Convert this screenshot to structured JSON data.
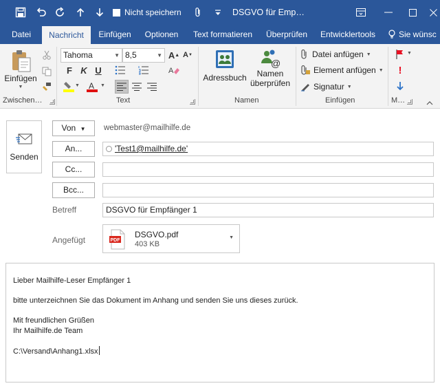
{
  "window": {
    "title": "DSGVO für Emp…",
    "quick_access": {
      "nosave_label": "Nicht speichern"
    }
  },
  "tabs": [
    {
      "label": "Datei"
    },
    {
      "label": "Nachricht"
    },
    {
      "label": "Einfügen"
    },
    {
      "label": "Optionen"
    },
    {
      "label": "Text formatieren"
    },
    {
      "label": "Überprüfen"
    },
    {
      "label": "Entwicklertools"
    }
  ],
  "tell_me": "Sie wünsc",
  "ribbon": {
    "clipboard": {
      "paste_label": "Einfügen",
      "group_label": "Zwischen…"
    },
    "text": {
      "font_name": "Tahoma",
      "font_size": "8,5",
      "bold": "F",
      "italic": "K",
      "underline": "U",
      "group_label": "Text"
    },
    "names": {
      "addressbook_label": "Adressbuch",
      "check_names_line1": "Namen",
      "check_names_line2": "überprüfen",
      "group_label": "Namen"
    },
    "include": {
      "attach_file": "Datei anfügen",
      "attach_item": "Element anfügen",
      "signature": "Signatur",
      "group_label": "Einfügen"
    },
    "tags": {
      "group_label": "M…"
    }
  },
  "compose": {
    "send_label": "Senden",
    "from_btn": "Von",
    "from_address": "webmaster@mailhilfe.de",
    "to_btn": "An...",
    "to_value": "'Test1@mailhilfe.de'",
    "cc_btn": "Cc...",
    "bcc_btn": "Bcc...",
    "subject_label": "Betreff",
    "subject_value": "DSGVO für Empfänger 1",
    "attached_label": "Angefügt",
    "attachment": {
      "name": "DSGVO.pdf",
      "size": "403 KB",
      "icon_text": "PDF"
    },
    "body_lines": {
      "greeting": "Lieber Mailhilfe-Leser Empfänger 1",
      "request": "bitte unterzeichnen Sie das Dokument im Anhang und senden Sie uns dieses zurück.",
      "closing": "Mit freundlichen Grüßen",
      "team": "Ihr Mailhilfe.de Team",
      "path": "C:\\Versand\\Anhang1.xlsx"
    }
  },
  "colors": {
    "titlebar": "#2b579a",
    "ribbon_bg": "#f3f3f3",
    "highlight_yellow": "#ffff00",
    "font_red": "#e01010",
    "importance_red": "#e81123",
    "importance_blue": "#2b72c7"
  }
}
